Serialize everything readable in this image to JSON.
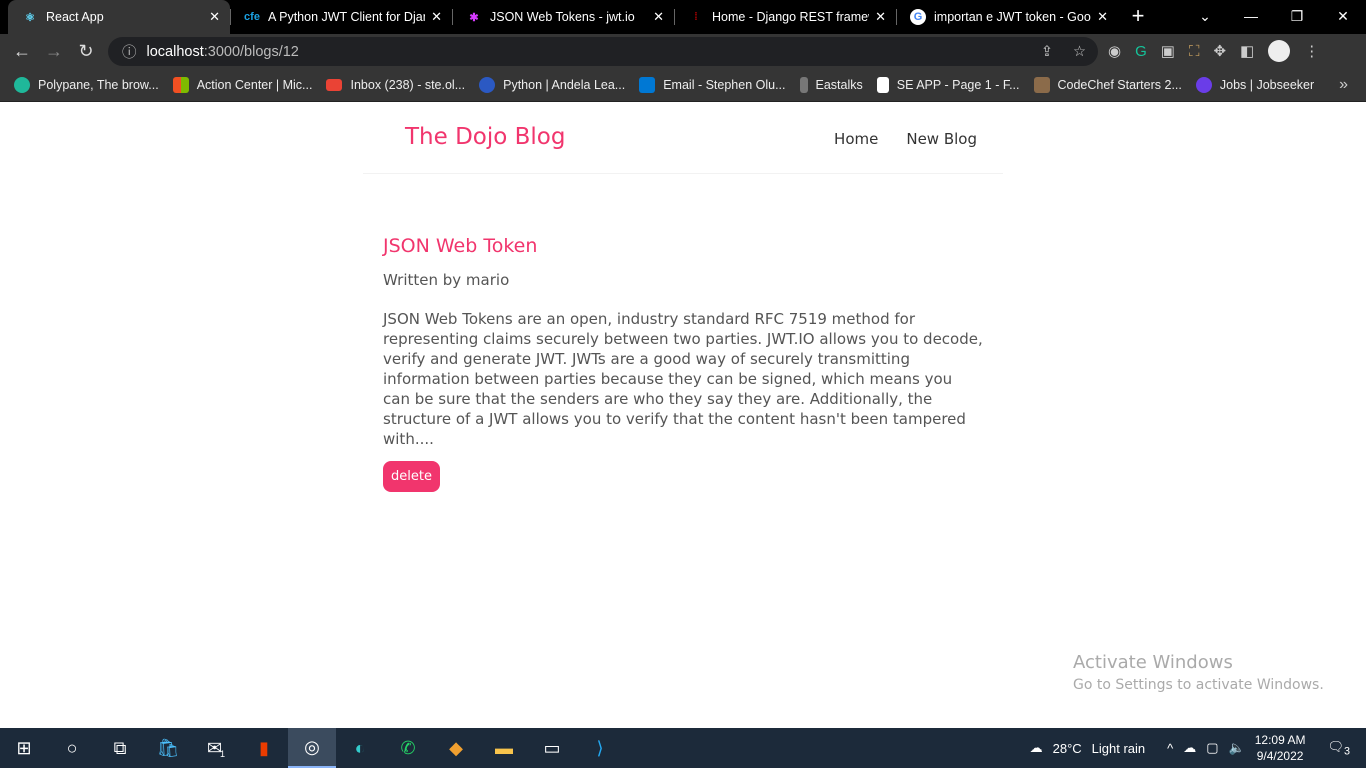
{
  "browser": {
    "tabs": [
      {
        "title": "React App",
        "icon": "react-icon",
        "active": true
      },
      {
        "title": "A Python JWT Client for Django",
        "icon": "cfe-icon"
      },
      {
        "title": "JSON Web Tokens - jwt.io",
        "icon": "jwt-icon"
      },
      {
        "title": "Home - Django REST framework",
        "icon": "drf-icon"
      },
      {
        "title": "importan e JWT token - Google",
        "icon": "google-icon"
      }
    ],
    "url_host": "localhost",
    "url_path": ":3000/blogs/12",
    "bookmarks": [
      {
        "label": "Polypane, The brow...",
        "color": "#1fb89a"
      },
      {
        "label": "Action Center | Mic...",
        "color": "#f25022"
      },
      {
        "label": "Inbox (238) - ste.ol...",
        "color": "#ea4335"
      },
      {
        "label": "Python | Andela Lea...",
        "color": "#2b59c3"
      },
      {
        "label": "Email - Stephen Olu...",
        "color": "#0078d4"
      },
      {
        "label": "Eastalks",
        "color": "#777777"
      },
      {
        "label": "SE APP - Page 1 - F...",
        "color": "#ffffff"
      },
      {
        "label": "CodeChef Starters 2...",
        "color": "#8b6b4a"
      },
      {
        "label": "Jobs | Jobseeker",
        "color": "#6a3de8"
      }
    ]
  },
  "site": {
    "brand": "The Dojo Blog",
    "nav": [
      "Home",
      "New Blog"
    ],
    "accent": "#f1356d"
  },
  "blog": {
    "title": "JSON Web Token",
    "author": "Written by mario",
    "body": "JSON Web Tokens are an open, industry standard RFC 7519 method for representing claims securely between two parties. JWT.IO allows you to decode, verify and generate JWT. JWTs are a good way of securely transmitting information between parties because they can be signed, which means you can be sure that the senders are who they say they are. Additionally, the structure of a JWT allows you to verify that the content hasn't been tampered with....",
    "delete_label": "delete"
  },
  "watermark": {
    "line1": "Activate Windows",
    "line2": "Go to Settings to activate Windows."
  },
  "taskbar": {
    "temp": "28°C",
    "weather": "Light rain",
    "time": "12:09 AM",
    "date": "9/4/2022",
    "notifications": "3",
    "mail_badge": "1"
  }
}
